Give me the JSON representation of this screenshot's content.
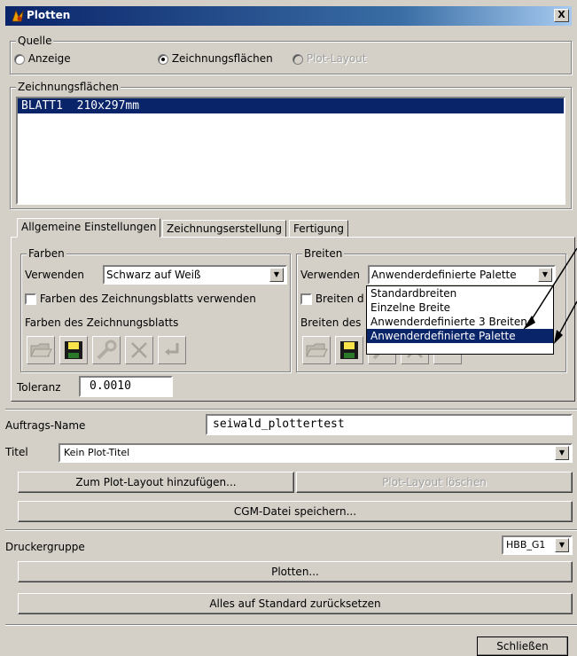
{
  "window": {
    "title": "Plotten",
    "close": "X"
  },
  "quelle": {
    "legend": "Quelle",
    "options": [
      {
        "label": "Anzeige",
        "checked": false,
        "disabled": false
      },
      {
        "label": "Zeichnungsflächen",
        "checked": true,
        "disabled": false
      },
      {
        "label": "Plot-Layout",
        "checked": false,
        "disabled": true
      }
    ]
  },
  "zeichnungsflaechen": {
    "legend": "Zeichnungsflächen",
    "items": [
      {
        "text": "BLATT1  210x297mm",
        "selected": true
      }
    ]
  },
  "tabs": [
    "Allgemeine Einstellungen",
    "Zeichnungserstellung",
    "Fertigung"
  ],
  "farben": {
    "legend": "Farben",
    "use_label": "Verwenden",
    "use_value": "Schwarz auf Weiß",
    "checkbox_label": "Farben des Zeichnungsblatts verwenden",
    "sub_label": "Farben des Zeichnungsblatts"
  },
  "breiten": {
    "legend": "Breiten",
    "use_label": "Verwenden",
    "use_value": "Anwenderdefinierte Palette",
    "checkbox_label_partial": "Breiten d",
    "sub_label_partial": "Breiten des",
    "options": [
      "Standardbreiten",
      "Einzelne Breite",
      "Anwenderdefinierte 3 Breiten",
      "Anwenderdefinierte Palette"
    ],
    "selected_index": 3
  },
  "toleranz": {
    "label": "Toleranz",
    "value": "0.0010"
  },
  "auftrag": {
    "label": "Auftrags-Name",
    "value": "seiwald_plottertest"
  },
  "titel": {
    "label": "Titel",
    "value": "Kein Plot-Titel"
  },
  "buttons": {
    "add_layout": "Zum Plot-Layout hinzufügen...",
    "delete_layout": "Plot-Layout löschen",
    "cgm": "CGM-Datei speichern...",
    "plot": "Plotten...",
    "reset": "Alles auf Standard zurücksetzen",
    "close": "Schließen"
  },
  "druckergruppe": {
    "label": "Druckergruppe",
    "value": "HBB_G1"
  },
  "colors": {
    "selection": "#0a246a",
    "face": "#d4d0c8"
  }
}
